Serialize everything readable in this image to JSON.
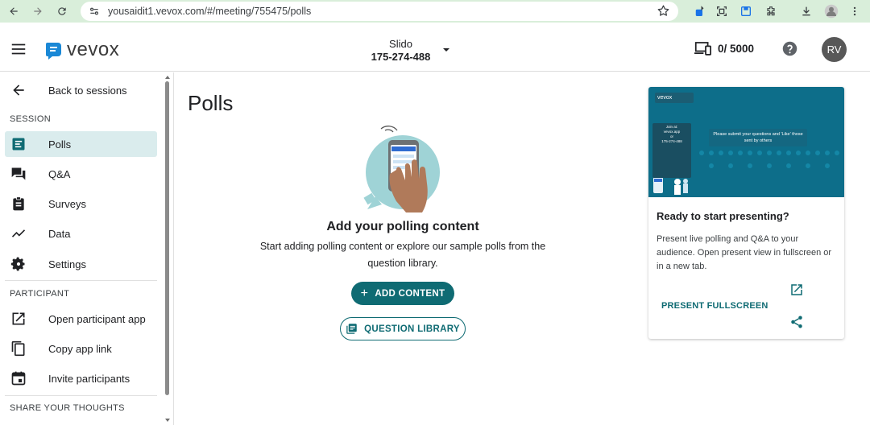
{
  "browser": {
    "url": "yousaidit1.vevox.com/#/meeting/755475/polls"
  },
  "header": {
    "logo_text": "vevox",
    "session_name": "Slido",
    "session_code": "175-274-488",
    "device_count": "0/ 5000",
    "avatar_initials": "RV"
  },
  "sidebar": {
    "back_label": "Back to sessions",
    "section_session": "SESSION",
    "items": [
      {
        "label": "Polls",
        "icon": "polls-icon",
        "active": true
      },
      {
        "label": "Q&A",
        "icon": "qa-icon"
      },
      {
        "label": "Surveys",
        "icon": "surveys-icon"
      },
      {
        "label": "Data",
        "icon": "data-icon"
      },
      {
        "label": "Settings",
        "icon": "gear-icon"
      }
    ],
    "section_participant": "PARTICIPANT",
    "participant_items": [
      {
        "label": "Open participant app",
        "icon": "open-external-icon"
      },
      {
        "label": "Copy app link",
        "icon": "copy-icon"
      },
      {
        "label": "Invite participants",
        "icon": "calendar-icon"
      }
    ],
    "section_feedback": "SHARE YOUR THOUGHTS"
  },
  "main": {
    "title": "Polls",
    "empty_title": "Add your polling content",
    "empty_sub": "Start adding polling content or explore our sample polls from the question library.",
    "add_button": "ADD CONTENT",
    "library_button": "QUESTION LIBRARY"
  },
  "present_card": {
    "preview_logo": "vevox",
    "preview_join_line1": "Join at:",
    "preview_join_line2": "vevox.app",
    "preview_join_line3": "or",
    "preview_join_code": "175-274-488",
    "preview_message": "Please submit your questions and 'Like' those sent by others",
    "ready_title": "Ready to start presenting?",
    "description": "Present live polling and Q&A to your audience. Open present view in fullscreen or in a new tab.",
    "fullscreen_label": "PRESENT FULLSCREEN"
  },
  "colors": {
    "accent": "#0f6b73",
    "active_bg": "#daeced",
    "preview_bg": "#0d6e8a",
    "chrome_bg": "#d9eeda"
  }
}
